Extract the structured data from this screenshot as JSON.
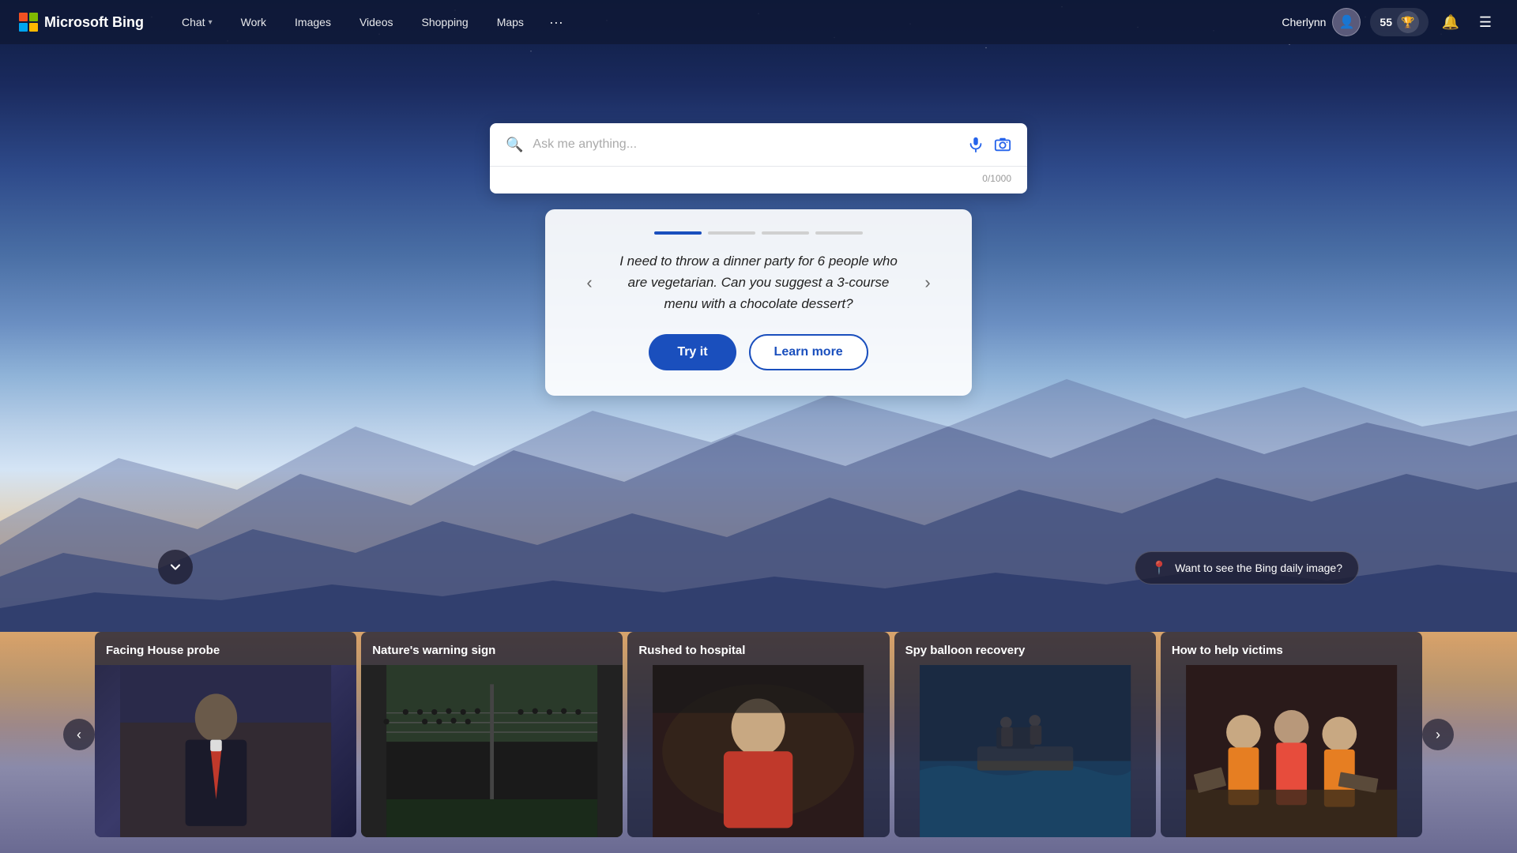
{
  "app": {
    "title": "Microsoft Bing"
  },
  "navbar": {
    "logo_text": "Microsoft Bing",
    "nav_items": [
      {
        "label": "Chat",
        "has_dropdown": true
      },
      {
        "label": "Work",
        "has_dropdown": false
      },
      {
        "label": "Images",
        "has_dropdown": false
      },
      {
        "label": "Videos",
        "has_dropdown": false
      },
      {
        "label": "Shopping",
        "has_dropdown": false
      },
      {
        "label": "Maps",
        "has_dropdown": false
      }
    ],
    "more_label": "···",
    "user_name": "Cherlynn",
    "points": "55",
    "bell_icon": "🔔",
    "hamburger_icon": "☰"
  },
  "search": {
    "placeholder": "Ask me anything...",
    "counter": "0/1000"
  },
  "suggestion_card": {
    "text": "I need to throw a dinner party for 6 people who are vegetarian. Can you suggest a 3-course menu with a chocolate dessert?",
    "try_label": "Try it",
    "learn_more_label": "Learn more",
    "dots": [
      "active",
      "inactive",
      "inactive",
      "inactive"
    ],
    "prev_arrow": "‹",
    "next_arrow": "›"
  },
  "scroll_down": {
    "icon": "⌄"
  },
  "daily_image": {
    "label": "Want to see the Bing daily image?"
  },
  "news": {
    "prev_arrow": "‹",
    "next_arrow": "›",
    "cards": [
      {
        "title": "Facing House probe",
        "img_class": "news-img-1"
      },
      {
        "title": "Nature's warning sign",
        "img_class": "news-img-2"
      },
      {
        "title": "Rushed to hospital",
        "img_class": "news-img-3"
      },
      {
        "title": "Spy balloon recovery",
        "img_class": "news-img-4"
      },
      {
        "title": "How to help victims",
        "img_class": "news-img-5"
      }
    ]
  }
}
